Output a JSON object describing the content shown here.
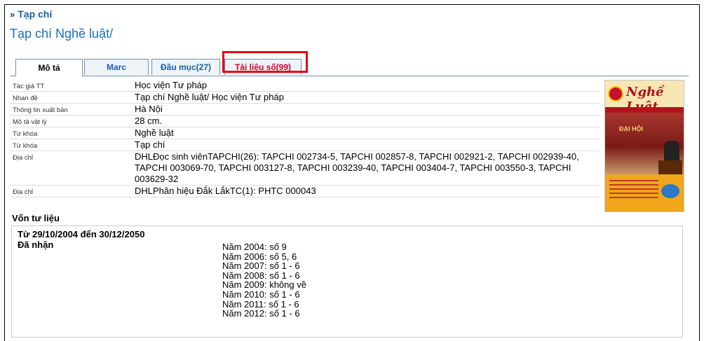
{
  "breadcrumb": {
    "arrow": "»",
    "label": "Tạp chí"
  },
  "page_title": "Tạp chí Nghề luật/",
  "tabs": [
    {
      "label": "Mô tả"
    },
    {
      "label": "Marc"
    },
    {
      "label": "Đầu mục(27)"
    },
    {
      "label": "Tài liệu số(99)"
    }
  ],
  "details": [
    {
      "label": "Tác giả TT",
      "value": "Học viện Tư pháp"
    },
    {
      "label": "Nhan đề",
      "value": "Tạp chí Nghề luật/ Học viện Tư pháp"
    },
    {
      "label": "Thông tin xuất bản",
      "value": "Hà Nội"
    },
    {
      "label": "Mô tả vật lý",
      "value": "28 cm."
    },
    {
      "label": "Từ khóa",
      "value": "Nghề luật"
    },
    {
      "label": "Từ khóa",
      "value": "Tạp chí"
    },
    {
      "label": "Địa chỉ",
      "value": "DHLĐọc sinh viênTAPCHI(26): TAPCHI 002734-5, TAPCHI 002857-8, TAPCHI 002921-2, TAPCHI 002939-40, TAPCHI 003069-70, TAPCHI 003127-8, TAPCHI 003239-40, TAPCHI 003404-7, TAPCHI 003550-3, TAPCHI 003629-32"
    },
    {
      "label": "Địa chỉ",
      "value": "DHLPhân hiệu Đắk LắkTC(1): PHTC 000043"
    }
  ],
  "cover": {
    "masthead": "Nghề Luật",
    "banner": "ĐẠI HỘI"
  },
  "holdings": {
    "title": "Vốn tư liệu",
    "range": "Từ 29/10/2004 đến 30/12/2050",
    "received_label": "Đã nhận",
    "issues": [
      "Năm 2004: số 9",
      "Năm 2006: số 5, 6",
      "Năm 2007: số 1 - 6",
      "Năm 2008: số 1 - 6",
      "Năm 2009: không về",
      "Năm 2010: số 1 - 6",
      "Năm 2011: số 1 - 6",
      "Năm 2012: số 1 - 6"
    ]
  },
  "colors": {
    "link": "#1a5fa8",
    "highlight": "#e3000f"
  }
}
